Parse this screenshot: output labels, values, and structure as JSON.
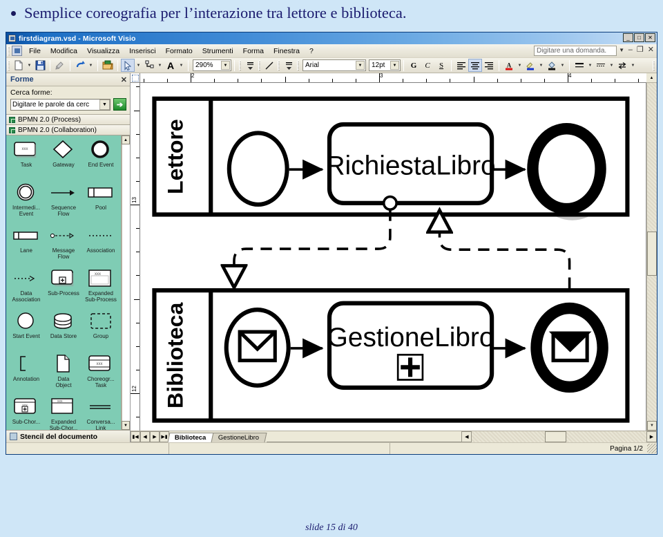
{
  "slide": {
    "bullet_text": "Semplice coreografia per l’interazione tra lettore e biblioteca.",
    "footer": "slide 15 di 40"
  },
  "window": {
    "title": "firstdiagram.vsd - Microsoft Visio",
    "controls": {
      "minimize": "_",
      "maximize": "□",
      "close": "✕"
    }
  },
  "menu": {
    "items": [
      "File",
      "Modifica",
      "Visualizza",
      "Inserisci",
      "Formato",
      "Strumenti",
      "Forma",
      "Finestra",
      "?"
    ],
    "ask_box": "Digitare una domanda.",
    "doc_controls": {
      "minimize": "–",
      "restore": "❐",
      "close": "✕"
    }
  },
  "toolbar": {
    "zoom_value": "290%",
    "font_name": "Arial",
    "font_size": "12pt",
    "bold_label": "G",
    "italic_label": "C",
    "underline_label": "S",
    "text_tool_label": "A",
    "icons": [
      "new-document-icon",
      "save-icon",
      "format-painter-icon",
      "undo-icon",
      "open-folder-icon",
      "pointer-tool-icon",
      "connector-tool-icon",
      "text-tool-icon",
      "line-weight-icon",
      "line-style-icon",
      "line-ends-icon",
      "align-left-icon",
      "align-center-icon",
      "align-right-icon",
      "font-color-icon",
      "line-color-icon",
      "fill-color-icon",
      "line-icon",
      "dash-icon",
      "arrow-icon"
    ]
  },
  "shapes_panel": {
    "title": "Forme",
    "close_label": "✕",
    "search_label": "Cerca forme:",
    "search_value": "Digitare le parole da cerc",
    "go_label": "➔",
    "stencils": [
      "BPMN 2.0 (Process)",
      "BPMN 2.0 (Collaboration)"
    ],
    "document_stencil": "Stencil del documento",
    "shapes": [
      {
        "label": "Task",
        "icon": "task-shape-icon"
      },
      {
        "label": "Gateway",
        "icon": "gateway-shape-icon"
      },
      {
        "label": "End Event",
        "icon": "end-event-shape-icon"
      },
      {
        "label": "Intermedi...\nEvent",
        "icon": "intermediate-event-shape-icon"
      },
      {
        "label": "Sequence\nFlow",
        "icon": "sequence-flow-shape-icon"
      },
      {
        "label": "Pool",
        "icon": "pool-shape-icon"
      },
      {
        "label": "Lane",
        "icon": "lane-shape-icon"
      },
      {
        "label": "Message\nFlow",
        "icon": "message-flow-shape-icon"
      },
      {
        "label": "Association",
        "icon": "association-shape-icon"
      },
      {
        "label": "Data\nAssociation",
        "icon": "data-association-shape-icon"
      },
      {
        "label": "Sub-Process",
        "icon": "sub-process-shape-icon"
      },
      {
        "label": "Expanded\nSub-Process",
        "icon": "expanded-sub-process-shape-icon"
      },
      {
        "label": "Start Event",
        "icon": "start-event-shape-icon"
      },
      {
        "label": "Data Store",
        "icon": "data-store-shape-icon"
      },
      {
        "label": "Group",
        "icon": "group-shape-icon"
      },
      {
        "label": "Annotation",
        "icon": "annotation-shape-icon"
      },
      {
        "label": "Data\nObject",
        "icon": "data-object-shape-icon"
      },
      {
        "label": "Choreogr...\nTask",
        "icon": "choreography-task-shape-icon"
      },
      {
        "label": "Sub-Chor...",
        "icon": "sub-choreography-shape-icon"
      },
      {
        "label": "Expanded\nSub-Chor...",
        "icon": "expanded-sub-choreography-shape-icon"
      },
      {
        "label": "Conversa...\nLink",
        "icon": "conversation-link-shape-icon"
      }
    ]
  },
  "rulers": {
    "horizontal_labels": [
      "2",
      "3",
      "4"
    ],
    "vertical_labels": [
      "13",
      "12"
    ]
  },
  "diagram": {
    "pools": [
      {
        "name": "Lettore",
        "elements": [
          {
            "type": "start-event",
            "label": ""
          },
          {
            "type": "task",
            "label": "RichiestaLibro"
          },
          {
            "type": "end-event",
            "label": ""
          }
        ]
      },
      {
        "name": "Biblioteca",
        "elements": [
          {
            "type": "message-start-event",
            "label": ""
          },
          {
            "type": "sub-process",
            "label": "GestioneLibro",
            "marker": "+"
          },
          {
            "type": "message-end-event",
            "label": ""
          }
        ]
      }
    ]
  },
  "page_tabs": {
    "nav": [
      "⏮",
      "◀",
      "▶",
      "⏭"
    ],
    "tabs": [
      "Biblioteca",
      "GestioneLibro"
    ],
    "active": "Biblioteca"
  },
  "status": {
    "page_indicator": "Pagina 1/2"
  },
  "colors": {
    "slide_bg": "#cfe6f7",
    "title_text": "#1a1a6e",
    "titlebar_start": "#0a4fa0",
    "chrome_bg": "#ece9d8",
    "palette_bg": "#7fccb4",
    "stencil_icon": "#2a8a4a"
  }
}
